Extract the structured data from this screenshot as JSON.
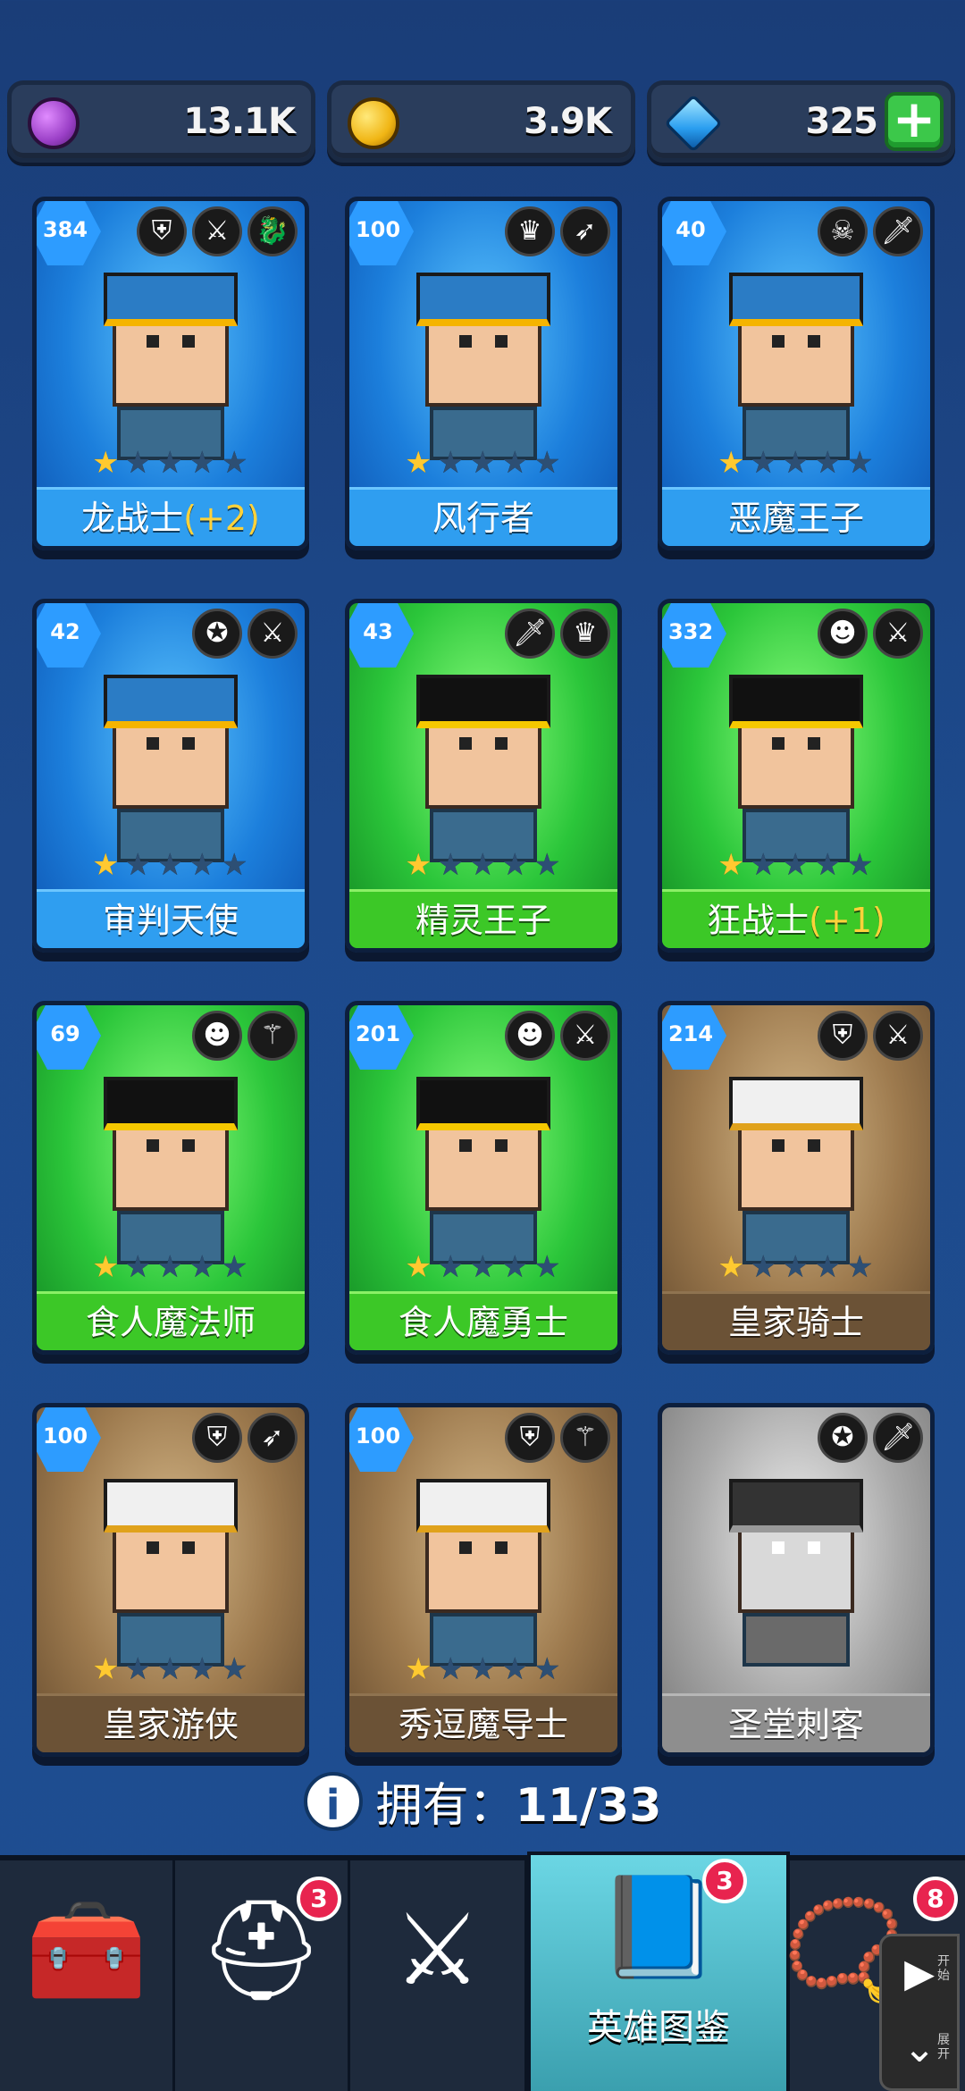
{
  "currencies": [
    {
      "value": "13.1K",
      "icon": "purple-orb-icon",
      "color": "#b05ed8"
    },
    {
      "value": "3.9K",
      "icon": "gold-coin-icon",
      "color": "#f4c21e"
    },
    {
      "value": "325",
      "icon": "blue-gem-icon",
      "color": "#3fb6ff",
      "plus": "+"
    }
  ],
  "heroes": [
    {
      "level": "384",
      "name": "龙战士",
      "bonus": "(+2)",
      "stars": 1,
      "theme": "blue",
      "badges": [
        "helmet-icon",
        "sword-icon",
        "dragon-icon"
      ]
    },
    {
      "level": "100",
      "name": "风行者",
      "bonus": "",
      "stars": 1,
      "theme": "blue",
      "badges": [
        "elf-icon",
        "bow-icon"
      ]
    },
    {
      "level": "40",
      "name": "恶魔王子",
      "bonus": "",
      "stars": 1,
      "theme": "blue",
      "badges": [
        "demon-skull-icon",
        "dagger-icon"
      ]
    },
    {
      "level": "42",
      "name": "审判天使",
      "bonus": "",
      "stars": 1,
      "theme": "blue",
      "badges": [
        "winged-emblem-icon",
        "sword-icon"
      ]
    },
    {
      "level": "43",
      "name": "精灵王子",
      "bonus": "",
      "stars": 1,
      "theme": "green",
      "badges": [
        "dagger-icon",
        "elf-icon"
      ]
    },
    {
      "level": "332",
      "name": "狂战士",
      "bonus": "(+1)",
      "stars": 1,
      "theme": "green",
      "badges": [
        "orc-icon",
        "sword-icon"
      ]
    },
    {
      "level": "69",
      "name": "食人魔法师",
      "bonus": "",
      "stars": 1,
      "theme": "green",
      "badges": [
        "orc-icon",
        "staff-icon"
      ]
    },
    {
      "level": "201",
      "name": "食人魔勇士",
      "bonus": "",
      "stars": 1,
      "theme": "green",
      "badges": [
        "orc-icon",
        "sword-icon"
      ]
    },
    {
      "level": "214",
      "name": "皇家骑士",
      "bonus": "",
      "stars": 1,
      "theme": "brown",
      "badges": [
        "helmet-icon",
        "sword-icon"
      ]
    },
    {
      "level": "100",
      "name": "皇家游侠",
      "bonus": "",
      "stars": 1,
      "theme": "brown",
      "badges": [
        "helmet-icon",
        "bow-icon"
      ]
    },
    {
      "level": "100",
      "name": "秀逗魔导士",
      "bonus": "",
      "stars": 1,
      "theme": "brown",
      "badges": [
        "helmet-icon",
        "staff-icon"
      ]
    },
    {
      "level": "",
      "name": "圣堂刺客",
      "bonus": "",
      "stars": 0,
      "theme": "gray",
      "badges": [
        "winged-emblem-icon",
        "dagger-icon"
      ]
    }
  ],
  "owned": {
    "info_icon": "i",
    "label": "拥有：",
    "count": "11/33"
  },
  "nav": [
    {
      "icon": "treasure-chest-icon",
      "glyph": "🧰",
      "label": "",
      "badge": ""
    },
    {
      "icon": "viking-helmet-icon",
      "glyph": "⛑",
      "label": "",
      "badge": "3"
    },
    {
      "icon": "crossed-swords-icon",
      "glyph": "⚔",
      "label": "",
      "badge": ""
    },
    {
      "icon": "hero-book-icon",
      "glyph": "📘",
      "label": "英雄图鉴",
      "badge": "3"
    },
    {
      "icon": "amulet-icon",
      "glyph": "📿",
      "label": "",
      "badge": "8"
    }
  ],
  "side_panel": {
    "play_label": "开始",
    "collapse_label": "展开"
  }
}
